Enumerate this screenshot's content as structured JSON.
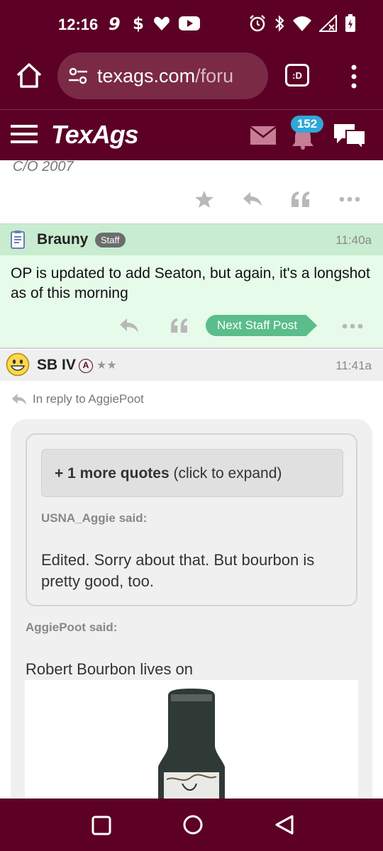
{
  "status_bar": {
    "time": "12:16",
    "left_icons": [
      "carrier-9-icon",
      "dollar-icon",
      "heart-icon",
      "youtube-icon"
    ],
    "right_icons": [
      "alarm-icon",
      "bluetooth-icon",
      "wifi-icon",
      "signal-icon",
      "battery-icon"
    ]
  },
  "browser": {
    "url_domain": "texags.com",
    "url_path": "/foru",
    "tab_switcher_label": ":D"
  },
  "site_header": {
    "logo": "TexAgs",
    "notification_count": "152"
  },
  "previous_post": {
    "signature": "C/O 2007"
  },
  "staff_post": {
    "username": "Brauny",
    "badge": "Staff",
    "time": "11:40a",
    "body": "OP is updated to add Seaton, but again, it's a longshot as of this morning",
    "next_staff_label": "Next Staff Post"
  },
  "reply_post": {
    "username": "SB IV",
    "affiliation_badge": "A",
    "stars": "★★",
    "time": "11:41a",
    "in_reply_to": "In reply to AggiePoot",
    "expand_bold": "+ 1 more quotes",
    "expand_rest": " (click to expand)",
    "inner_said": "USNA_Aggie said:",
    "inner_text": "Edited. Sorry about that. But bourbon is pretty good, too.",
    "outer_said": "AggiePoot said:",
    "outer_text": "Robert Bourbon lives on"
  },
  "colors": {
    "brand_maroon": "#5c0025",
    "staff_green_header": "#c8ecd0",
    "staff_green_body": "#e6fbe9",
    "next_staff_green": "#5bbd8a",
    "badge_blue": "#2fa7d8"
  }
}
